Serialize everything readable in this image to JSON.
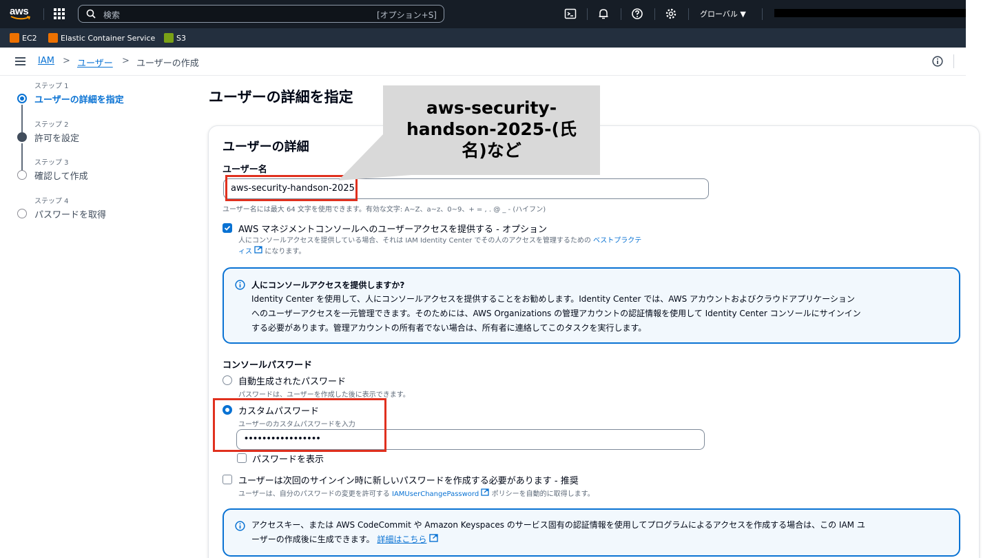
{
  "topnav": {
    "logo": "aws",
    "search_placeholder": "検索",
    "search_shortcut": "[オプション+S]",
    "region": "グローバル ▼"
  },
  "favorites": [
    {
      "label": "EC2",
      "color": "#ed7100"
    },
    {
      "label": "Elastic Container Service",
      "color": "#ed7100"
    },
    {
      "label": "S3",
      "color": "#7aa116"
    }
  ],
  "breadcrumb": {
    "items": [
      "IAM",
      "ユーザー",
      "ユーザーの作成"
    ],
    "separator": ">"
  },
  "steps": [
    {
      "label": "ステップ 1",
      "title": "ユーザーの詳細を指定",
      "state": "active"
    },
    {
      "label": "ステップ 2",
      "title": "許可を設定",
      "state": "filled"
    },
    {
      "label": "ステップ 3",
      "title": "確認して作成",
      "state": "empty"
    },
    {
      "label": "ステップ 4",
      "title": "パスワードを取得",
      "state": "empty"
    }
  ],
  "main": {
    "page_title": "ユーザーの詳細を指定",
    "card_title": "ユーザーの詳細",
    "username_label": "ユーザー名",
    "username_value": "aws-security-handson-2025",
    "username_hint": "ユーザー名には最大 64 文字を使用できます。有効な文字: A~Z、a~z、0~9、+ = , . @ _ - (ハイフン)",
    "console_access_label": "AWS マネジメントコンソールへのユーザーアクセスを提供する - オプション",
    "console_access_desc1": "人にコンソールアクセスを提供している場合、それは IAM Identity Center でその人のアクセスを管理するための",
    "console_access_link": "ベストプラクテ",
    "console_access_link2": "ィス",
    "console_access_desc2": "になります。",
    "alert1_title": "人にコンソールアクセスを提供しますか?",
    "alert1_line1": "Identity Center を使用して、人にコンソールアクセスを提供することをお勧めします。Identity Center では、AWS アカウントおよびクラウドアプリケーション",
    "alert1_line2": "へのユーザーアクセスを一元管理できます。そのためには、AWS Organizations の管理アカウントの認証情報を使用して Identity Center コンソールにサインイン",
    "alert1_line3": "する必要があります。管理アカウントの所有者でない場合は、所有者に連絡してこのタスクを実行します。",
    "password_section": "コンソールパスワード",
    "auto_password_label": "自動生成されたパスワード",
    "auto_password_desc": "パスワードは、ユーザーを作成した後に表示できます。",
    "custom_password_label": "カスタムパスワード",
    "custom_password_desc": "ユーザーのカスタムパスワードを入力",
    "custom_password_value": "•••••••••••••••••",
    "show_password_label": "パスワードを表示",
    "reset_required_label": "ユーザーは次回のサインイン時に新しいパスワードを作成する必要があります - 推奨",
    "reset_required_desc1": "ユーザーは、自分のパスワードの変更を許可する",
    "reset_required_policy": "IAMUserChangePassword",
    "reset_required_desc2": "ポリシーを自動的に取得します。",
    "alert2_line1": "アクセスキー、または AWS CodeCommit や Amazon Keyspaces のサービス固有の認証情報を使用してプログラムによるアクセスを作成する場合は、この IAM ユ",
    "alert2_line2": "ーザーの作成後に生成できます。",
    "alert2_link": "詳細はこちら"
  },
  "annotation": {
    "callout_line1": "aws-security-",
    "callout_line2": "handson-2025-(氏",
    "callout_line3": "名)など"
  },
  "colors": {
    "nav_bg": "#161d26",
    "accent": "#0972d3",
    "highlight": "#e0301e"
  }
}
